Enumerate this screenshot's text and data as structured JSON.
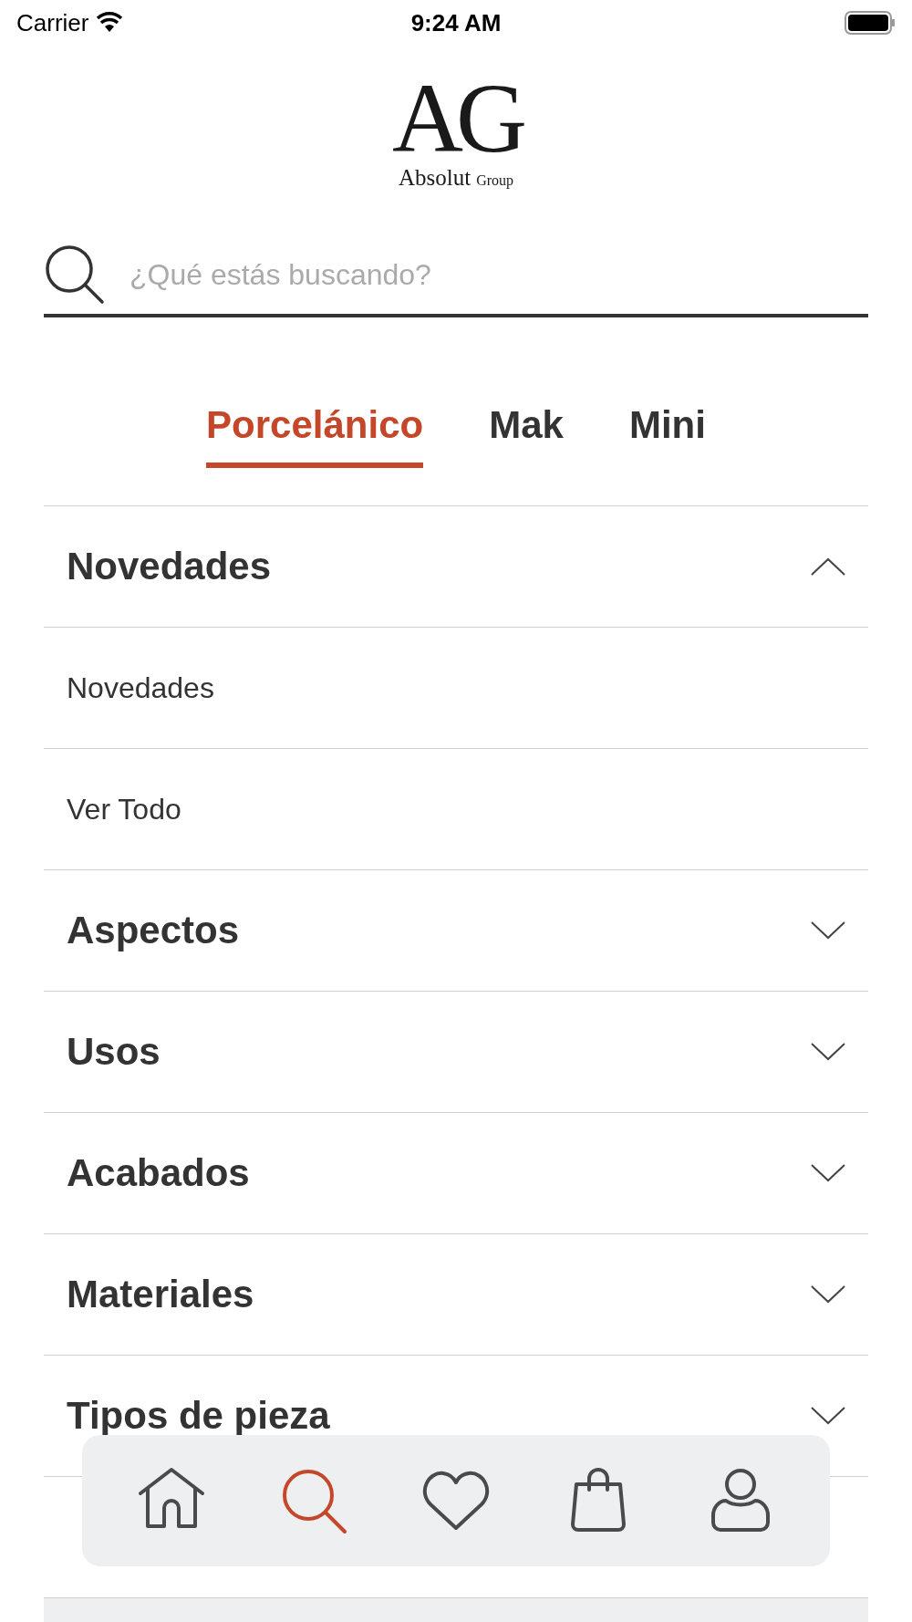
{
  "status_bar": {
    "carrier": "Carrier",
    "time": "9:24 AM"
  },
  "logo": {
    "mark": "AG",
    "name": "Absolut",
    "suffix": "Group"
  },
  "search": {
    "placeholder": "¿Qué estás buscando?"
  },
  "tabs": [
    {
      "label": "Porcelánico",
      "selected": true
    },
    {
      "label": "Mak",
      "selected": false
    },
    {
      "label": "Mini",
      "selected": false
    }
  ],
  "menu": [
    {
      "kind": "section",
      "label": "Novedades",
      "expanded": true
    },
    {
      "kind": "item",
      "label": "Novedades"
    },
    {
      "kind": "item",
      "label": "Ver Todo"
    },
    {
      "kind": "section",
      "label": "Aspectos",
      "expanded": false
    },
    {
      "kind": "section",
      "label": "Usos",
      "expanded": false
    },
    {
      "kind": "section",
      "label": "Acabados",
      "expanded": false
    },
    {
      "kind": "section",
      "label": "Materiales",
      "expanded": false
    },
    {
      "kind": "section",
      "label": "Tipos de pieza",
      "expanded": false
    }
  ],
  "tab_bar": [
    {
      "selected": false
    },
    {
      "selected": true
    },
    {
      "selected": false
    },
    {
      "selected": false
    },
    {
      "selected": false
    }
  ]
}
